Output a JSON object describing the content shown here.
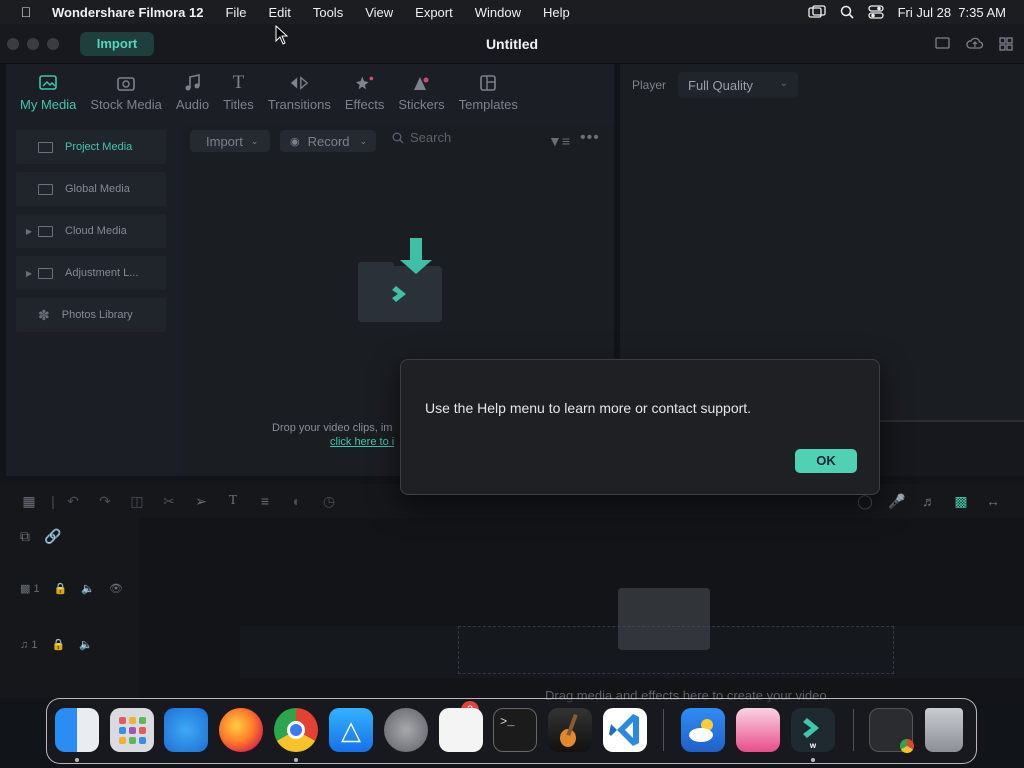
{
  "menubar": {
    "app_name": "Wondershare Filmora 12",
    "items": [
      "File",
      "Edit",
      "Tools",
      "View",
      "Export",
      "Window",
      "Help"
    ],
    "clock": "Fri Jul 28  7:35 AM"
  },
  "titlebar": {
    "import_label": "Import",
    "title": "Untitled"
  },
  "tabs": [
    {
      "label": "My Media",
      "icon": "my-media-icon"
    },
    {
      "label": "Stock Media",
      "icon": "stock-media-icon"
    },
    {
      "label": "Audio",
      "icon": "audio-icon"
    },
    {
      "label": "Titles",
      "icon": "titles-icon"
    },
    {
      "label": "Transitions",
      "icon": "transitions-icon"
    },
    {
      "label": "Effects",
      "icon": "effects-icon"
    },
    {
      "label": "Stickers",
      "icon": "stickers-icon"
    },
    {
      "label": "Templates",
      "icon": "templates-icon"
    }
  ],
  "sidebar": {
    "items": [
      {
        "label": "Project Media",
        "icon": "folder-icon"
      },
      {
        "label": "Global Media",
        "icon": "folder-icon"
      },
      {
        "label": "Cloud Media",
        "icon": "folder-icon"
      },
      {
        "label": "Adjustment L...",
        "icon": "folder-icon"
      },
      {
        "label": "Photos Library",
        "icon": "photos-icon"
      }
    ]
  },
  "media": {
    "import_label": "Import",
    "record_label": "Record",
    "search_placeholder": "Search",
    "drop_text": "Drop your video clips, im",
    "drop_link": "click here to i"
  },
  "player": {
    "label": "Player",
    "quality": "Full Quality"
  },
  "timeline": {
    "video_track": "1",
    "audio_track": "1",
    "drag_text": "Drag media and effects here to create your video."
  },
  "dialog": {
    "message": "Use the Help menu to learn more or contact support.",
    "ok_label": "OK"
  },
  "dock": {
    "settings_badge": "2",
    "apps": [
      "Finder",
      "Launchpad",
      "Safari",
      "Firefox",
      "Chrome",
      "App Store",
      "System Settings",
      "TextEdit",
      "Terminal",
      "GarageBand",
      "VS Code",
      "Weather",
      "Screens",
      "Filmora",
      "Chrome Window",
      "Trash"
    ]
  }
}
